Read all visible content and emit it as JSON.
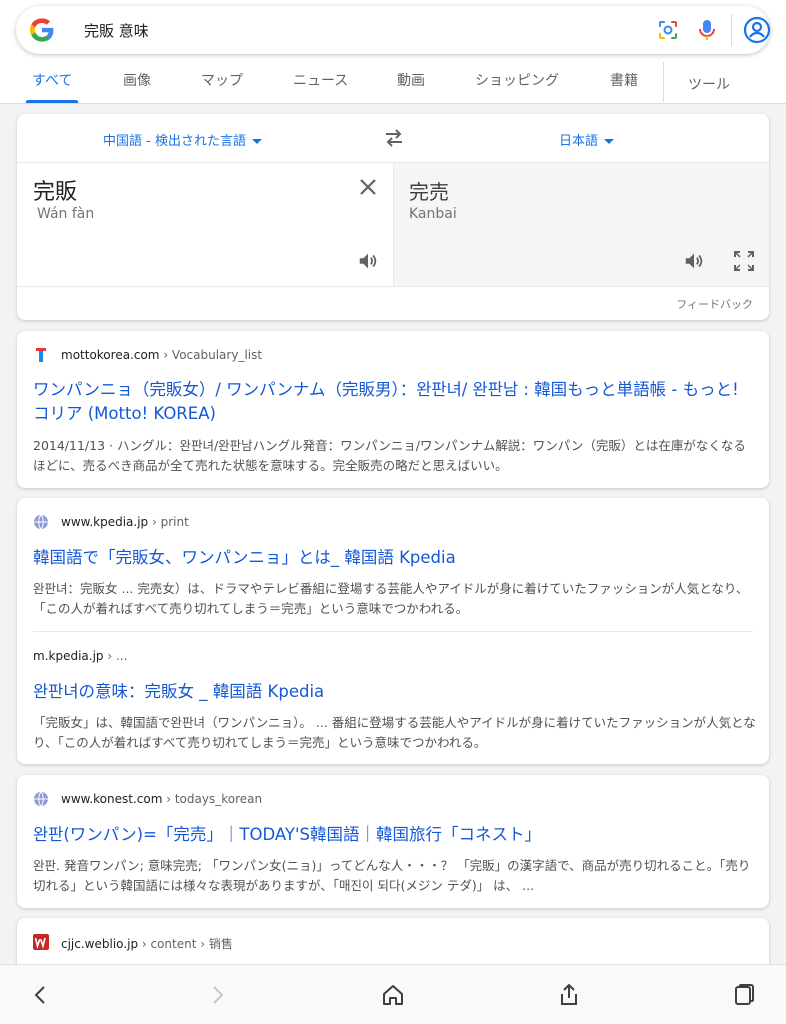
{
  "search": {
    "query": "完販 意味"
  },
  "tabs": [
    {
      "label": "すべて",
      "active": true
    },
    {
      "label": "画像"
    },
    {
      "label": "マップ"
    },
    {
      "label": "ニュース"
    },
    {
      "label": "動画"
    },
    {
      "label": "ショッピング"
    },
    {
      "label": "書籍"
    },
    {
      "label": "ツール"
    }
  ],
  "translate": {
    "source_lang": "中国語 - 検出された言語",
    "target_lang": "日本語",
    "source_text": "完販",
    "source_romanization": "Wán fàn",
    "target_text": "完売",
    "target_romanization": "Kanbai",
    "feedback": "フィードバック"
  },
  "results": [
    {
      "site": "mottokorea.com",
      "crumb": " › Vocabulary_list",
      "title": "ワンパンニョ（完販女）/ ワンパンナム（完販男）：완판녀/ 완판남 : 韓国もっと単語帳 - もっと! コリア (Motto! KOREA)",
      "snippet": "2014/11/13 · ハングル：완판녀/완판남ハングル発音：ワンパンニョ/ワンパンナム解説：ワンパン（完販）とは在庫がなくなるほどに、売るべき商品が全て売れた状態を意味する。完全販売の略だと思えばいい。"
    },
    {
      "site": "www.kpedia.jp",
      "crumb": " › print",
      "title": "韓国語で「完販女、ワンパンニョ」とは_ 韓国語 Kpedia",
      "snippet": "완판녀：完販女 ... 完売女）は、ドラマやテレビ番組に登場する芸能人やアイドルが身に着けていたファッションが人気となり、「この人が着ればすべて売り切れてしまう＝完売」という意味でつかわれる。",
      "sub": {
        "site": "m.kpedia.jp",
        "crumb": " › ...",
        "title": "완판녀の意味：完販女 _ 韓国語 Kpedia",
        "snippet": "「完販女」は、韓国語で완판녀（ワンパンニョ）。 ... 番組に登場する芸能人やアイドルが身に着けていたファッションが人気となり、「この人が着ればすべて売り切れてしまう＝完売」という意味でつかわれる。"
      }
    },
    {
      "site": "www.konest.com",
      "crumb": " › todays_korean",
      "title": "완판(ワンパン)=「完売」｜TODAY'S韓国語｜韓国旅行「コネスト」",
      "snippet": "완판. 発音ワンパン; 意味完売; 「ワンパン女(ニョ)」ってどんな人・・・？ 「完販」の漢字語で、商品が売り切れること。「売り切れる」という韓国語には様々な表現がありますが、「매진이 되다(メジン テダ)」 は、 ..."
    },
    {
      "site": "cjjc.weblio.jp",
      "crumb": " › content › 销售"
    }
  ],
  "icons": {
    "google_logo": "google-g-logo",
    "lens": "lens-icon",
    "mic": "mic-icon",
    "account": "account-icon",
    "swap": "swap-icon",
    "clear": "close-icon",
    "speaker": "speaker-icon",
    "expand": "fullscreen-icon",
    "back": "back-icon",
    "forward": "forward-icon",
    "home": "home-icon",
    "share": "share-icon",
    "tabs": "tabs-icon"
  },
  "colors": {
    "link": "#1558d6",
    "accent": "#1a73e8"
  }
}
